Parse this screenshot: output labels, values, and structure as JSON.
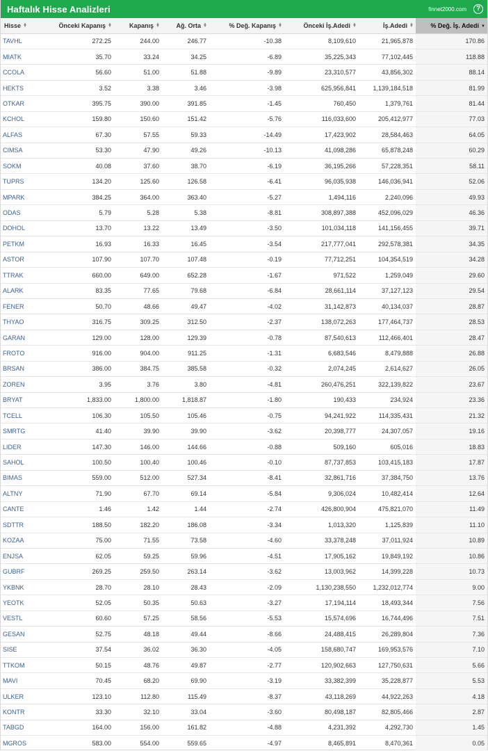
{
  "header": {
    "title": "Haftalık Hisse Analizleri",
    "site": "finnet2000.com",
    "help_glyph": "?"
  },
  "table": {
    "columns": [
      {
        "label": "Hisse",
        "key": "symbol"
      },
      {
        "label": "Önceki Kapanış",
        "key": "prev_close"
      },
      {
        "label": "Kapanış",
        "key": "close"
      },
      {
        "label": "Ağ. Orta",
        "key": "wavg"
      },
      {
        "label": "% Değ. Kapanış",
        "key": "chg_close"
      },
      {
        "label": "Önceki İş.Adedi",
        "key": "prev_vol"
      },
      {
        "label": "İş.Adedi",
        "key": "vol"
      },
      {
        "label": "% Değ. İş. Adedi",
        "key": "chg_vol"
      }
    ],
    "sorted_column": "% Değ. İş. Adedi",
    "sort_direction": "descending",
    "rows": [
      [
        "TAVHL",
        "272.25",
        "244.00",
        "246.77",
        "-10.38",
        "8,109,610",
        "21,965,878",
        "170.86"
      ],
      [
        "MIATK",
        "35.70",
        "33.24",
        "34.25",
        "-6.89",
        "35,225,343",
        "77,102,445",
        "118.88"
      ],
      [
        "CCOLA",
        "56.60",
        "51.00",
        "51.88",
        "-9.89",
        "23,310,577",
        "43,856,302",
        "88.14"
      ],
      [
        "HEKTS",
        "3.52",
        "3.38",
        "3.46",
        "-3.98",
        "625,956,841",
        "1,139,184,518",
        "81.99"
      ],
      [
        "OTKAR",
        "395.75",
        "390.00",
        "391.85",
        "-1.45",
        "760,450",
        "1,379,761",
        "81.44"
      ],
      [
        "KCHOL",
        "159.80",
        "150.60",
        "151.42",
        "-5.76",
        "116,033,600",
        "205,412,977",
        "77.03"
      ],
      [
        "ALFAS",
        "67.30",
        "57.55",
        "59.33",
        "-14.49",
        "17,423,902",
        "28,584,463",
        "64.05"
      ],
      [
        "CIMSA",
        "53.30",
        "47.90",
        "49.26",
        "-10.13",
        "41,098,286",
        "65,878,248",
        "60.29"
      ],
      [
        "SOKM",
        "40.08",
        "37.60",
        "38.70",
        "-6.19",
        "36,195,266",
        "57,228,351",
        "58.11"
      ],
      [
        "TUPRS",
        "134.20",
        "125.60",
        "126.58",
        "-6.41",
        "96,035,938",
        "146,036,941",
        "52.06"
      ],
      [
        "MPARK",
        "384.25",
        "364.00",
        "363.40",
        "-5.27",
        "1,494,116",
        "2,240,096",
        "49.93"
      ],
      [
        "ODAS",
        "5.79",
        "5.28",
        "5.38",
        "-8.81",
        "308,897,388",
        "452,096,029",
        "46.36"
      ],
      [
        "DOHOL",
        "13.70",
        "13.22",
        "13.49",
        "-3.50",
        "101,034,118",
        "141,156,455",
        "39.71"
      ],
      [
        "PETKM",
        "16.93",
        "16.33",
        "16.45",
        "-3.54",
        "217,777,041",
        "292,578,381",
        "34.35"
      ],
      [
        "ASTOR",
        "107.90",
        "107.70",
        "107.48",
        "-0.19",
        "77,712,251",
        "104,354,519",
        "34.28"
      ],
      [
        "TTRAK",
        "660.00",
        "649.00",
        "652.28",
        "-1.67",
        "971,522",
        "1,259,049",
        "29.60"
      ],
      [
        "ALARK",
        "83.35",
        "77.65",
        "79.68",
        "-6.84",
        "28,661,114",
        "37,127,123",
        "29.54"
      ],
      [
        "FENER",
        "50.70",
        "48.66",
        "49.47",
        "-4.02",
        "31,142,873",
        "40,134,037",
        "28.87"
      ],
      [
        "THYAO",
        "316.75",
        "309.25",
        "312.50",
        "-2.37",
        "138,072,263",
        "177,464,737",
        "28.53"
      ],
      [
        "GARAN",
        "129.00",
        "128.00",
        "129.39",
        "-0.78",
        "87,540,613",
        "112,466,401",
        "28.47"
      ],
      [
        "FROTO",
        "916.00",
        "904.00",
        "911.25",
        "-1.31",
        "6,683,546",
        "8,479,888",
        "26.88"
      ],
      [
        "BRSAN",
        "386.00",
        "384.75",
        "385.58",
        "-0.32",
        "2,074,245",
        "2,614,627",
        "26.05"
      ],
      [
        "ZOREN",
        "3.95",
        "3.76",
        "3.80",
        "-4.81",
        "260,476,251",
        "322,139,822",
        "23.67"
      ],
      [
        "BRYAT",
        "1,833.00",
        "1,800.00",
        "1,818.87",
        "-1.80",
        "190,433",
        "234,924",
        "23.36"
      ],
      [
        "TCELL",
        "106.30",
        "105.50",
        "105.46",
        "-0.75",
        "94,241,922",
        "114,335,431",
        "21.32"
      ],
      [
        "SMRTG",
        "41.40",
        "39.90",
        "39.90",
        "-3.62",
        "20,398,777",
        "24,307,057",
        "19.16"
      ],
      [
        "LIDER",
        "147.30",
        "146.00",
        "144.66",
        "-0.88",
        "509,160",
        "605,016",
        "18.83"
      ],
      [
        "SAHOL",
        "100.50",
        "100.40",
        "100.46",
        "-0.10",
        "87,737,853",
        "103,415,183",
        "17.87"
      ],
      [
        "BIMAS",
        "559.00",
        "512.00",
        "527.34",
        "-8.41",
        "32,861,716",
        "37,384,750",
        "13.76"
      ],
      [
        "ALTNY",
        "71.90",
        "67.70",
        "69.14",
        "-5.84",
        "9,306,024",
        "10,482,414",
        "12.64"
      ],
      [
        "CANTE",
        "1.46",
        "1.42",
        "1.44",
        "-2.74",
        "426,800,904",
        "475,821,070",
        "11.49"
      ],
      [
        "SDTTR",
        "188.50",
        "182.20",
        "186.08",
        "-3.34",
        "1,013,320",
        "1,125,839",
        "11.10"
      ],
      [
        "KOZAA",
        "75.00",
        "71.55",
        "73.58",
        "-4.60",
        "33,378,248",
        "37,011,924",
        "10.89"
      ],
      [
        "ENJSA",
        "62.05",
        "59.25",
        "59.96",
        "-4.51",
        "17,905,162",
        "19,849,192",
        "10.86"
      ],
      [
        "GUBRF",
        "269.25",
        "259.50",
        "263.14",
        "-3.62",
        "13,003,962",
        "14,399,228",
        "10.73"
      ],
      [
        "YKBNK",
        "28.70",
        "28.10",
        "28.43",
        "-2.09",
        "1,130,238,550",
        "1,232,012,774",
        "9.00"
      ],
      [
        "YEOTK",
        "52.05",
        "50.35",
        "50.63",
        "-3.27",
        "17,194,114",
        "18,493,344",
        "7.56"
      ],
      [
        "VESTL",
        "60.60",
        "57.25",
        "58.56",
        "-5.53",
        "15,574,696",
        "16,744,496",
        "7.51"
      ],
      [
        "GESAN",
        "52.75",
        "48.18",
        "49.44",
        "-8.66",
        "24,488,415",
        "26,289,804",
        "7.36"
      ],
      [
        "SISE",
        "37.54",
        "36.02",
        "36.30",
        "-4.05",
        "158,680,747",
        "169,953,576",
        "7.10"
      ],
      [
        "TTKOM",
        "50.15",
        "48.76",
        "49.87",
        "-2.77",
        "120,902,663",
        "127,750,631",
        "5.66"
      ],
      [
        "MAVI",
        "70.45",
        "68.20",
        "69.90",
        "-3.19",
        "33,382,399",
        "35,228,877",
        "5.53"
      ],
      [
        "ULKER",
        "123.10",
        "112.80",
        "115.49",
        "-8.37",
        "43,118,269",
        "44,922,263",
        "4.18"
      ],
      [
        "KONTR",
        "33.30",
        "32.10",
        "33.04",
        "-3.60",
        "80,498,187",
        "82,805,466",
        "2.87"
      ],
      [
        "TABGD",
        "164.00",
        "156.00",
        "161.82",
        "-4.88",
        "4,231,392",
        "4,292,730",
        "1.45"
      ],
      [
        "MGROS",
        "583.00",
        "554.00",
        "559.65",
        "-4.97",
        "8,465,891",
        "8,470,361",
        "0.05"
      ]
    ]
  },
  "colors": {
    "header_green": "#1fa84e",
    "symbol_link": "#3c5f8d",
    "active_sort_header": "#bfbfbf"
  }
}
